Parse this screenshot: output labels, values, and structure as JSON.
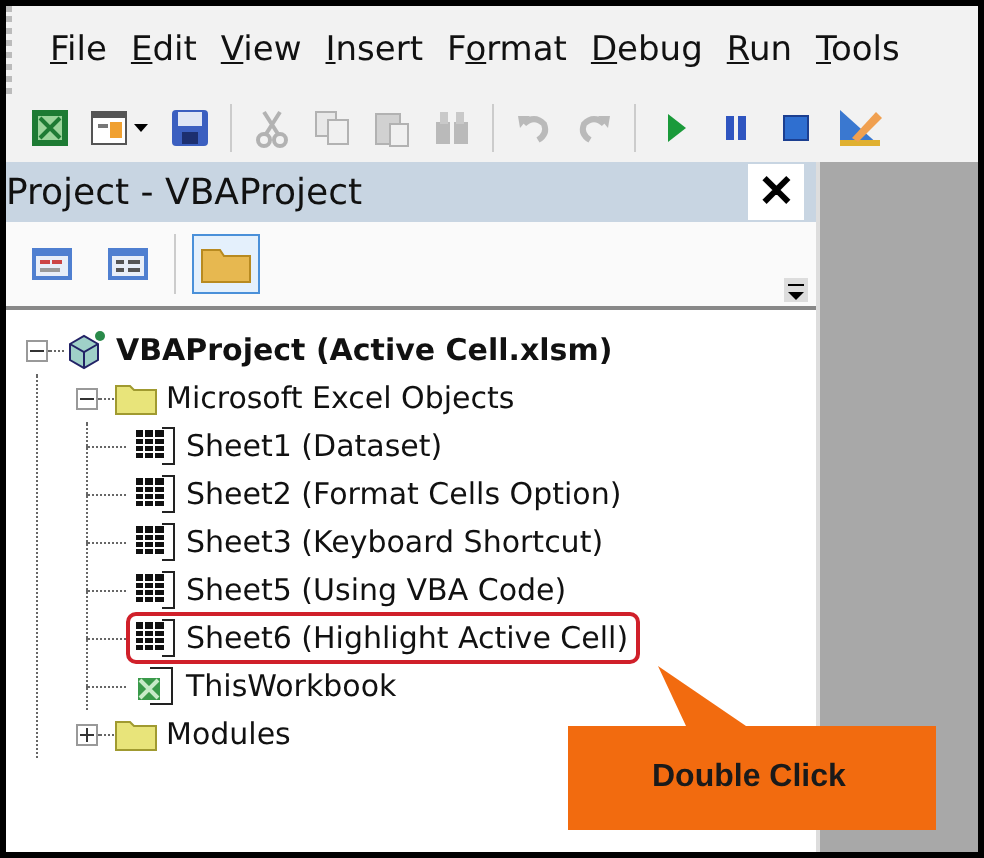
{
  "menu": [
    {
      "key": "F",
      "after": "ile"
    },
    {
      "key": "E",
      "after": "dit"
    },
    {
      "key": "V",
      "after": "iew"
    },
    {
      "key": "I",
      "after": "nsert"
    },
    {
      "before": "F",
      "key": "o",
      "after": "rmat"
    },
    {
      "key": "D",
      "after": "ebug"
    },
    {
      "key": "R",
      "after": "un"
    },
    {
      "key": "T",
      "after": "ools"
    }
  ],
  "toolbar": [
    {
      "disabled": false
    },
    {
      "disabled": false
    },
    {
      "disabled": false
    },
    {
      "disabled": true
    },
    {
      "disabled": true
    },
    {
      "disabled": true
    },
    {
      "disabled": true
    },
    {
      "disabled": true
    },
    {
      "disabled": true
    },
    {
      "disabled": false
    },
    {
      "disabled": false
    },
    {
      "disabled": false
    },
    {
      "disabled": false
    }
  ],
  "project_panel": {
    "title": "Project - VBAProject",
    "close": "✕",
    "toolbar": [
      {
        "selected": false
      },
      {
        "selected": false
      },
      {
        "selected": true
      }
    ],
    "tree": [
      {
        "label": "VBAProject (Active Cell.xlsm)",
        "kind": "project",
        "expanded": true,
        "children": [
          {
            "label": "Microsoft Excel Objects",
            "kind": "folder",
            "expanded": true,
            "children": [
              {
                "label": "Sheet1 (Dataset)",
                "kind": "sheet",
                "highlighted": false
              },
              {
                "label": "Sheet2 (Format Cells Option)",
                "kind": "sheet",
                "highlighted": false
              },
              {
                "label": "Sheet3 (Keyboard Shortcut)",
                "kind": "sheet",
                "highlighted": false
              },
              {
                "label": "Sheet5 (Using VBA Code)",
                "kind": "sheet",
                "highlighted": false
              },
              {
                "label": "Sheet6 (Highlight Active Cell)",
                "kind": "sheet",
                "highlighted": true
              },
              {
                "label": "ThisWorkbook",
                "kind": "workbook",
                "highlighted": false
              }
            ]
          },
          {
            "label": "Modules",
            "kind": "folder",
            "expanded": false
          }
        ]
      }
    ]
  },
  "callout": {
    "text": "Double Click"
  }
}
